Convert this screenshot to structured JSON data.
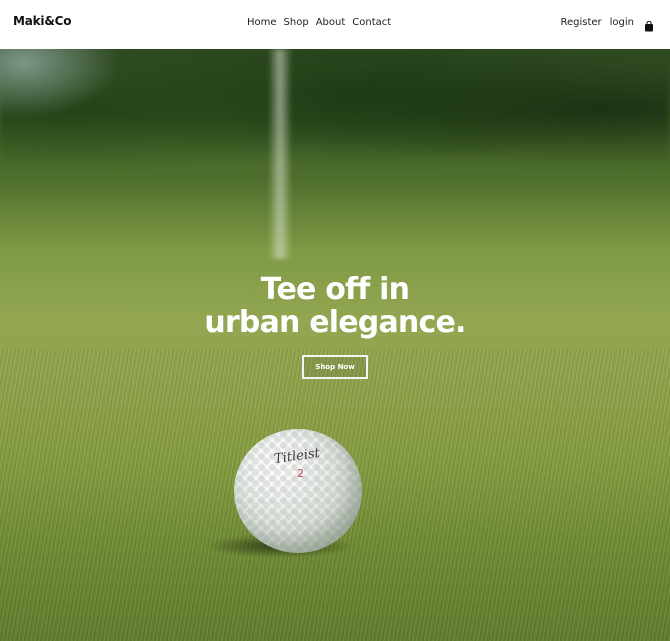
{
  "navbar": {
    "logo": "Maki&Co",
    "links": [
      "Home",
      "Shop",
      "About",
      "Contact"
    ],
    "register": "Register",
    "login": "login",
    "cart_icon": "shopping-bag-icon"
  },
  "hero": {
    "title_line1": "Tee off in",
    "title_line2": "urban elegance.",
    "cta": "Shop Now",
    "ball_brand": "Titleist",
    "ball_number": "2"
  },
  "colors": {
    "background": "#ffffff",
    "text_dark": "#111111",
    "hero_text": "#ffffff",
    "grass": "#8ea049"
  }
}
